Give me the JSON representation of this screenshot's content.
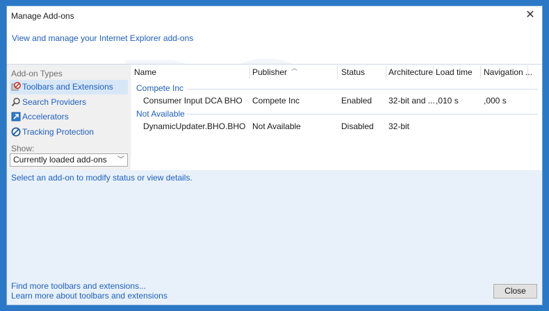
{
  "window": {
    "title": "Manage Add-ons",
    "header_link": "View and manage your Internet Explorer add-ons"
  },
  "sidebar": {
    "types_label": "Add-on Types",
    "items": [
      {
        "label": "Toolbars and Extensions",
        "icon": "toolbar-extension-icon"
      },
      {
        "label": "Search Providers",
        "icon": "search-icon"
      },
      {
        "label": "Accelerators",
        "icon": "accelerator-icon"
      },
      {
        "label": "Tracking Protection",
        "icon": "tracking-protection-icon"
      }
    ],
    "show_label": "Show:",
    "show_value": "Currently loaded add-ons"
  },
  "table": {
    "columns": [
      "Name",
      "Publisher",
      "Status",
      "Architecture",
      "Load time",
      "Navigation ..."
    ],
    "groups": [
      {
        "label": "Compete Inc",
        "rows": [
          {
            "name": "Consumer Input DCA BHO",
            "publisher": "Compete Inc",
            "status": "Enabled",
            "architecture": "32-bit and ...",
            "load_time": ",010 s",
            "navigation": ",000 s"
          }
        ]
      },
      {
        "label": "Not Available",
        "rows": [
          {
            "name": "DynamicUpdater.BHO.BHO",
            "publisher": "Not Available",
            "status": "Disabled",
            "architecture": "32-bit",
            "load_time": "",
            "navigation": ""
          }
        ]
      }
    ]
  },
  "details": {
    "status_message": "Select an add-on to modify status or view details."
  },
  "footer": {
    "link1": "Find more toolbars and extensions...",
    "link2": "Learn more about toolbars and extensions",
    "close_label": "Close"
  },
  "colors": {
    "accent": "#1f5fbf",
    "frame": "#2b78c7",
    "selected_bg": "#d7e7f8",
    "detail_bg": "#e8f1fa"
  }
}
